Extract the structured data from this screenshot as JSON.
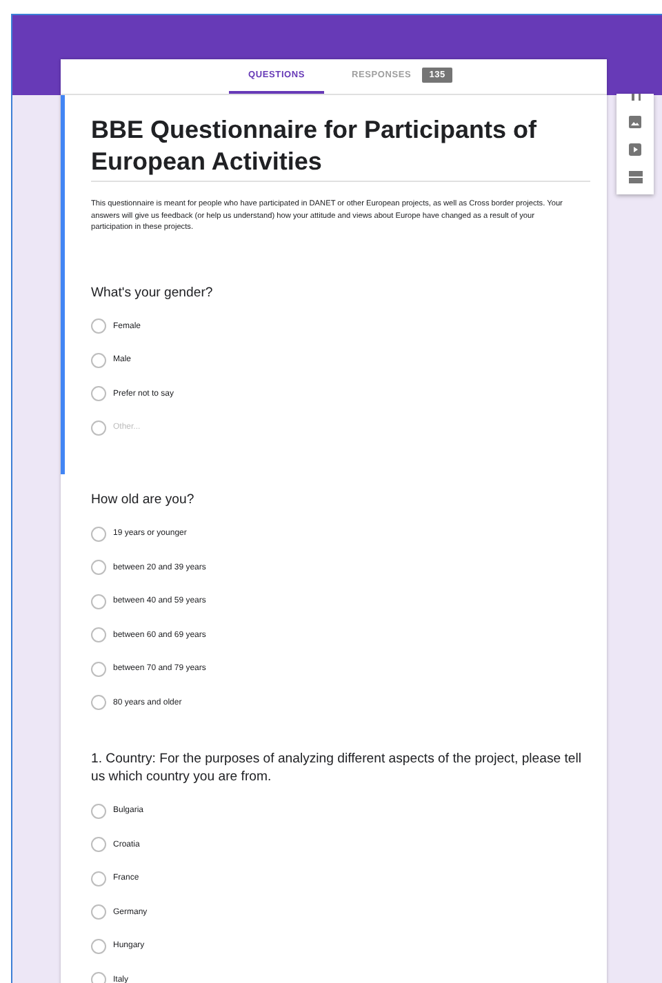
{
  "tabs": [
    {
      "label": "QUESTIONS",
      "selected": true
    },
    {
      "label": "RESPONSES",
      "selected": false,
      "count": "135"
    }
  ],
  "sections": [
    {
      "selected": true,
      "title": "BBE Questionnaire for Participants of European Activities",
      "description": "This questionnaire is meant for people who have participated in DANET or other European projects, as well as Cross border projects. Your answers will give us feedback (or help us understand) how your attitude and views about Europe have changed as a result of your participation in these projects.",
      "questions": [
        {
          "text": "What's your gender?",
          "options": [
            {
              "label": "Female",
              "kind": "choice",
              "selected": false
            },
            {
              "label": "Male",
              "kind": "choice",
              "selected": false
            },
            {
              "label": "Prefer not to say",
              "kind": "choice",
              "selected": false
            },
            {
              "label": "Other...",
              "kind": "other",
              "selected": false
            }
          ]
        }
      ]
    },
    {
      "selected": false,
      "questions": [
        {
          "text": "How old are you?",
          "options": [
            {
              "label": "19 years or younger",
              "kind": "choice",
              "selected": false
            },
            {
              "label": "between 20 and 39 years",
              "kind": "choice",
              "selected": false
            },
            {
              "label": "between 40 and 59 years",
              "kind": "choice",
              "selected": false
            },
            {
              "label": "between 60 and 69 years",
              "kind": "choice",
              "selected": false
            },
            {
              "label": "between 70 and 79 years",
              "kind": "choice",
              "selected": false
            },
            {
              "label": "80 years and older",
              "kind": "choice",
              "selected": false
            }
          ]
        },
        {
          "text": "1. Country: For the purposes of analyzing different aspects of the project, please tell us which country you are from.",
          "options": [
            {
              "label": "Bulgaria",
              "kind": "choice",
              "selected": false
            },
            {
              "label": "Croatia",
              "kind": "choice",
              "selected": false
            },
            {
              "label": "France",
              "kind": "choice",
              "selected": false
            },
            {
              "label": "Germany",
              "kind": "choice",
              "selected": false
            },
            {
              "label": "Hungary",
              "kind": "choice",
              "selected": false
            },
            {
              "label": "Italy",
              "kind": "choice",
              "selected": false
            }
          ]
        }
      ]
    }
  ]
}
